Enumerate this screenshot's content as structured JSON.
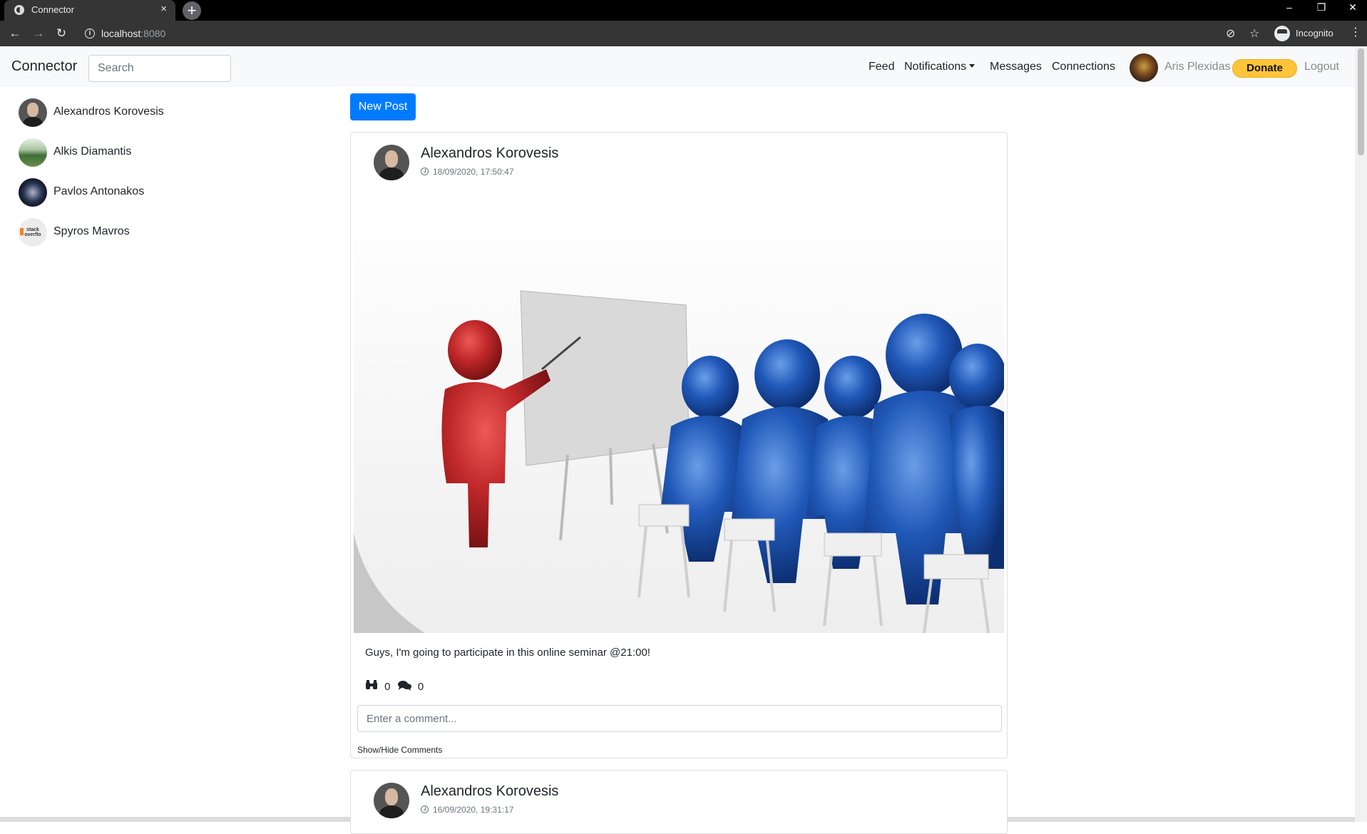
{
  "browser": {
    "tab_title": "Connector",
    "tab_close": "×",
    "new_tab": "+",
    "window_controls": {
      "minimize": "–",
      "restore": "❐",
      "close": "✕"
    },
    "back": "←",
    "forward": "→",
    "reload": "↻",
    "info": "i",
    "url_host": "localhost",
    "url_port": ":8080",
    "eye_off": "⊘",
    "bookmark": "☆",
    "profile_label": "Incognito",
    "menu": "⋮"
  },
  "navbar": {
    "brand": "Connector",
    "search_placeholder": "Search",
    "links": {
      "feed": "Feed",
      "notifications": "Notifications",
      "messages": "Messages",
      "connections": "Connections"
    },
    "user_name": "Aris Plexidas",
    "donate": "Donate",
    "logout": "Logout"
  },
  "sidebar": {
    "contacts": [
      {
        "name": "Alexandros Korovesis",
        "avatar": "person-photo"
      },
      {
        "name": "Alkis Diamantis",
        "avatar": "landscape-photo"
      },
      {
        "name": "Pavlos Antonakos",
        "avatar": "space-photo"
      },
      {
        "name": "Spyros Mavros",
        "avatar": "stackoverflow-logo"
      }
    ],
    "so_logo_text": "stack overflo"
  },
  "feed": {
    "new_post": "New Post",
    "posts": [
      {
        "author": "Alexandros Korovesis",
        "timestamp": "18/09/2020, 17:50:47",
        "image": "presentation-illustration",
        "text": "Guys, I'm going to participate in this online seminar @21:00!",
        "interest_count": "0",
        "comment_count": "0",
        "comment_placeholder": "Enter a comment...",
        "toggle_comments": "Show/Hide Comments"
      },
      {
        "author": "Alexandros Korovesis",
        "timestamp": "16/09/2020, 19:31:17"
      }
    ]
  },
  "colors": {
    "primary": "#007bff",
    "donate": "#ffc439",
    "navbar_bg": "#f8f9fa",
    "presenter": "#c0282a",
    "audience": "#1f5bb5"
  }
}
